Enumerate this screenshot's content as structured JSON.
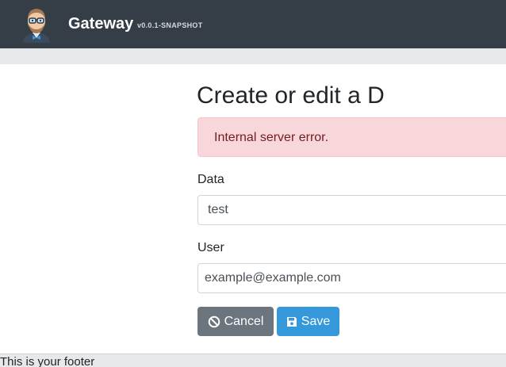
{
  "navbar": {
    "brand": "Gateway",
    "version": "v0.0.1-SNAPSHOT",
    "logo_icon": "avatar-logo-icon"
  },
  "page": {
    "title": "Create or edit a D"
  },
  "alert": {
    "message": "Internal server error."
  },
  "form": {
    "data_label": "Data",
    "data_value": "test",
    "user_label": "User",
    "user_value": "example@example.com"
  },
  "buttons": {
    "cancel_label": "Cancel",
    "cancel_icon": "ban-icon",
    "save_label": "Save",
    "save_icon": "floppy-disk-icon"
  },
  "footer": {
    "text": "This is your footer"
  },
  "colors": {
    "navbar_bg": "#353d47",
    "alert_bg": "#f8d7da",
    "alert_text": "#721c24",
    "cancel_bg": "#6c757d",
    "save_bg": "#3498db"
  }
}
